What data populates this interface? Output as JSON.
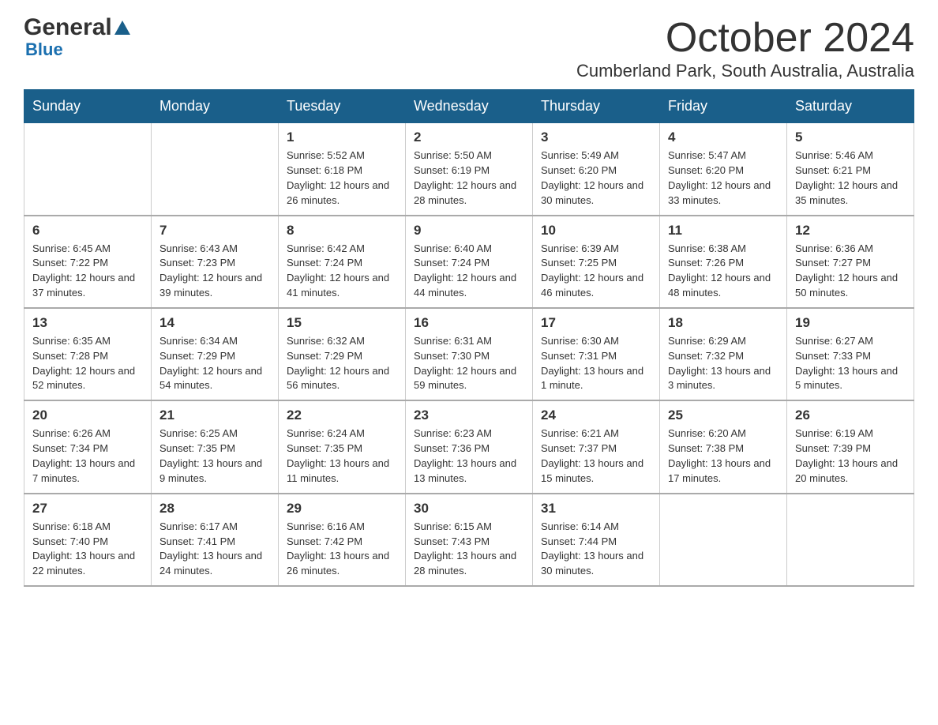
{
  "header": {
    "logo_general": "General",
    "logo_blue": "Blue",
    "month_title": "October 2024",
    "location": "Cumberland Park, South Australia, Australia"
  },
  "days_of_week": [
    "Sunday",
    "Monday",
    "Tuesday",
    "Wednesday",
    "Thursday",
    "Friday",
    "Saturday"
  ],
  "weeks": [
    [
      {
        "day": "",
        "info": ""
      },
      {
        "day": "",
        "info": ""
      },
      {
        "day": "1",
        "info": "Sunrise: 5:52 AM\nSunset: 6:18 PM\nDaylight: 12 hours\nand 26 minutes."
      },
      {
        "day": "2",
        "info": "Sunrise: 5:50 AM\nSunset: 6:19 PM\nDaylight: 12 hours\nand 28 minutes."
      },
      {
        "day": "3",
        "info": "Sunrise: 5:49 AM\nSunset: 6:20 PM\nDaylight: 12 hours\nand 30 minutes."
      },
      {
        "day": "4",
        "info": "Sunrise: 5:47 AM\nSunset: 6:20 PM\nDaylight: 12 hours\nand 33 minutes."
      },
      {
        "day": "5",
        "info": "Sunrise: 5:46 AM\nSunset: 6:21 PM\nDaylight: 12 hours\nand 35 minutes."
      }
    ],
    [
      {
        "day": "6",
        "info": "Sunrise: 6:45 AM\nSunset: 7:22 PM\nDaylight: 12 hours\nand 37 minutes."
      },
      {
        "day": "7",
        "info": "Sunrise: 6:43 AM\nSunset: 7:23 PM\nDaylight: 12 hours\nand 39 minutes."
      },
      {
        "day": "8",
        "info": "Sunrise: 6:42 AM\nSunset: 7:24 PM\nDaylight: 12 hours\nand 41 minutes."
      },
      {
        "day": "9",
        "info": "Sunrise: 6:40 AM\nSunset: 7:24 PM\nDaylight: 12 hours\nand 44 minutes."
      },
      {
        "day": "10",
        "info": "Sunrise: 6:39 AM\nSunset: 7:25 PM\nDaylight: 12 hours\nand 46 minutes."
      },
      {
        "day": "11",
        "info": "Sunrise: 6:38 AM\nSunset: 7:26 PM\nDaylight: 12 hours\nand 48 minutes."
      },
      {
        "day": "12",
        "info": "Sunrise: 6:36 AM\nSunset: 7:27 PM\nDaylight: 12 hours\nand 50 minutes."
      }
    ],
    [
      {
        "day": "13",
        "info": "Sunrise: 6:35 AM\nSunset: 7:28 PM\nDaylight: 12 hours\nand 52 minutes."
      },
      {
        "day": "14",
        "info": "Sunrise: 6:34 AM\nSunset: 7:29 PM\nDaylight: 12 hours\nand 54 minutes."
      },
      {
        "day": "15",
        "info": "Sunrise: 6:32 AM\nSunset: 7:29 PM\nDaylight: 12 hours\nand 56 minutes."
      },
      {
        "day": "16",
        "info": "Sunrise: 6:31 AM\nSunset: 7:30 PM\nDaylight: 12 hours\nand 59 minutes."
      },
      {
        "day": "17",
        "info": "Sunrise: 6:30 AM\nSunset: 7:31 PM\nDaylight: 13 hours\nand 1 minute."
      },
      {
        "day": "18",
        "info": "Sunrise: 6:29 AM\nSunset: 7:32 PM\nDaylight: 13 hours\nand 3 minutes."
      },
      {
        "day": "19",
        "info": "Sunrise: 6:27 AM\nSunset: 7:33 PM\nDaylight: 13 hours\nand 5 minutes."
      }
    ],
    [
      {
        "day": "20",
        "info": "Sunrise: 6:26 AM\nSunset: 7:34 PM\nDaylight: 13 hours\nand 7 minutes."
      },
      {
        "day": "21",
        "info": "Sunrise: 6:25 AM\nSunset: 7:35 PM\nDaylight: 13 hours\nand 9 minutes."
      },
      {
        "day": "22",
        "info": "Sunrise: 6:24 AM\nSunset: 7:35 PM\nDaylight: 13 hours\nand 11 minutes."
      },
      {
        "day": "23",
        "info": "Sunrise: 6:23 AM\nSunset: 7:36 PM\nDaylight: 13 hours\nand 13 minutes."
      },
      {
        "day": "24",
        "info": "Sunrise: 6:21 AM\nSunset: 7:37 PM\nDaylight: 13 hours\nand 15 minutes."
      },
      {
        "day": "25",
        "info": "Sunrise: 6:20 AM\nSunset: 7:38 PM\nDaylight: 13 hours\nand 17 minutes."
      },
      {
        "day": "26",
        "info": "Sunrise: 6:19 AM\nSunset: 7:39 PM\nDaylight: 13 hours\nand 20 minutes."
      }
    ],
    [
      {
        "day": "27",
        "info": "Sunrise: 6:18 AM\nSunset: 7:40 PM\nDaylight: 13 hours\nand 22 minutes."
      },
      {
        "day": "28",
        "info": "Sunrise: 6:17 AM\nSunset: 7:41 PM\nDaylight: 13 hours\nand 24 minutes."
      },
      {
        "day": "29",
        "info": "Sunrise: 6:16 AM\nSunset: 7:42 PM\nDaylight: 13 hours\nand 26 minutes."
      },
      {
        "day": "30",
        "info": "Sunrise: 6:15 AM\nSunset: 7:43 PM\nDaylight: 13 hours\nand 28 minutes."
      },
      {
        "day": "31",
        "info": "Sunrise: 6:14 AM\nSunset: 7:44 PM\nDaylight: 13 hours\nand 30 minutes."
      },
      {
        "day": "",
        "info": ""
      },
      {
        "day": "",
        "info": ""
      }
    ]
  ]
}
